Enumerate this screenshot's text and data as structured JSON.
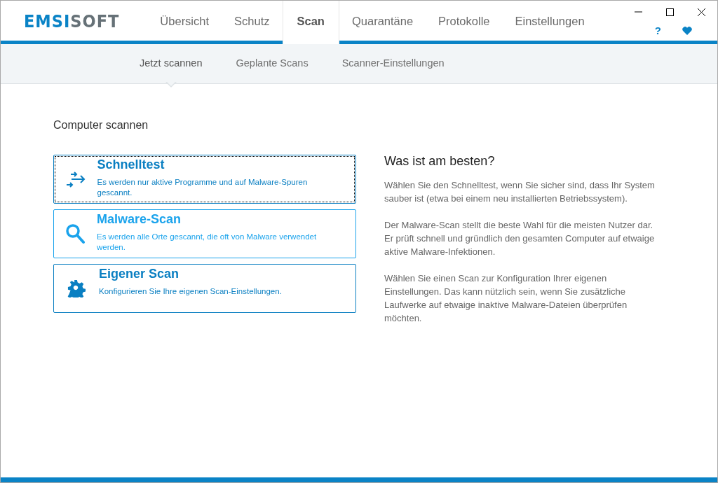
{
  "logo": {
    "first": "EMSI",
    "second": "SOFT"
  },
  "tabs": [
    {
      "label": "Übersicht",
      "selected": false
    },
    {
      "label": "Schutz",
      "selected": false
    },
    {
      "label": "Scan",
      "selected": true
    },
    {
      "label": "Quarantäne",
      "selected": false
    },
    {
      "label": "Protokolle",
      "selected": false
    },
    {
      "label": "Einstellungen",
      "selected": false
    }
  ],
  "header_icons": {
    "help": "?"
  },
  "subtabs": [
    {
      "label": "Jetzt scannen",
      "selected": true
    },
    {
      "label": "Geplante Scans",
      "selected": false
    },
    {
      "label": "Scanner-Einstellungen",
      "selected": false
    }
  ],
  "section_title": "Computer scannen",
  "scan_options": [
    {
      "kind": "quick",
      "title": "Schnelltest",
      "description": "Es werden nur aktive Programme und auf Malware-Spuren gescannt.",
      "focused": true,
      "hovered": false
    },
    {
      "kind": "malware",
      "title": "Malware-Scan",
      "description": "Es werden alle Orte gescannt, die oft von Malware verwendet werden.",
      "focused": false,
      "hovered": true
    },
    {
      "kind": "custom",
      "title": "Eigener Scan",
      "description": "Konfigurieren Sie Ihre eigenen Scan-Einstellungen.",
      "focused": false,
      "hovered": false
    }
  ],
  "help": {
    "title": "Was ist am besten?",
    "paragraphs": [
      "Wählen Sie den Schnelltest, wenn Sie sicher sind, dass Ihr System sauber ist (etwa bei einem neu installierten Betriebssystem).",
      "Der Malware-Scan stellt die beste Wahl für die meisten Nutzer dar. Er prüft schnell und gründlich den gesamten Computer auf etwaige aktive Malware-Infektionen.",
      "Wählen Sie einen Scan zur Konfiguration Ihrer eigenen Einstellungen. Das kann nützlich sein, wenn Sie zusätzliche Laufwerke auf etwaige inaktive Malware-Dateien überprüfen möchten."
    ]
  }
}
